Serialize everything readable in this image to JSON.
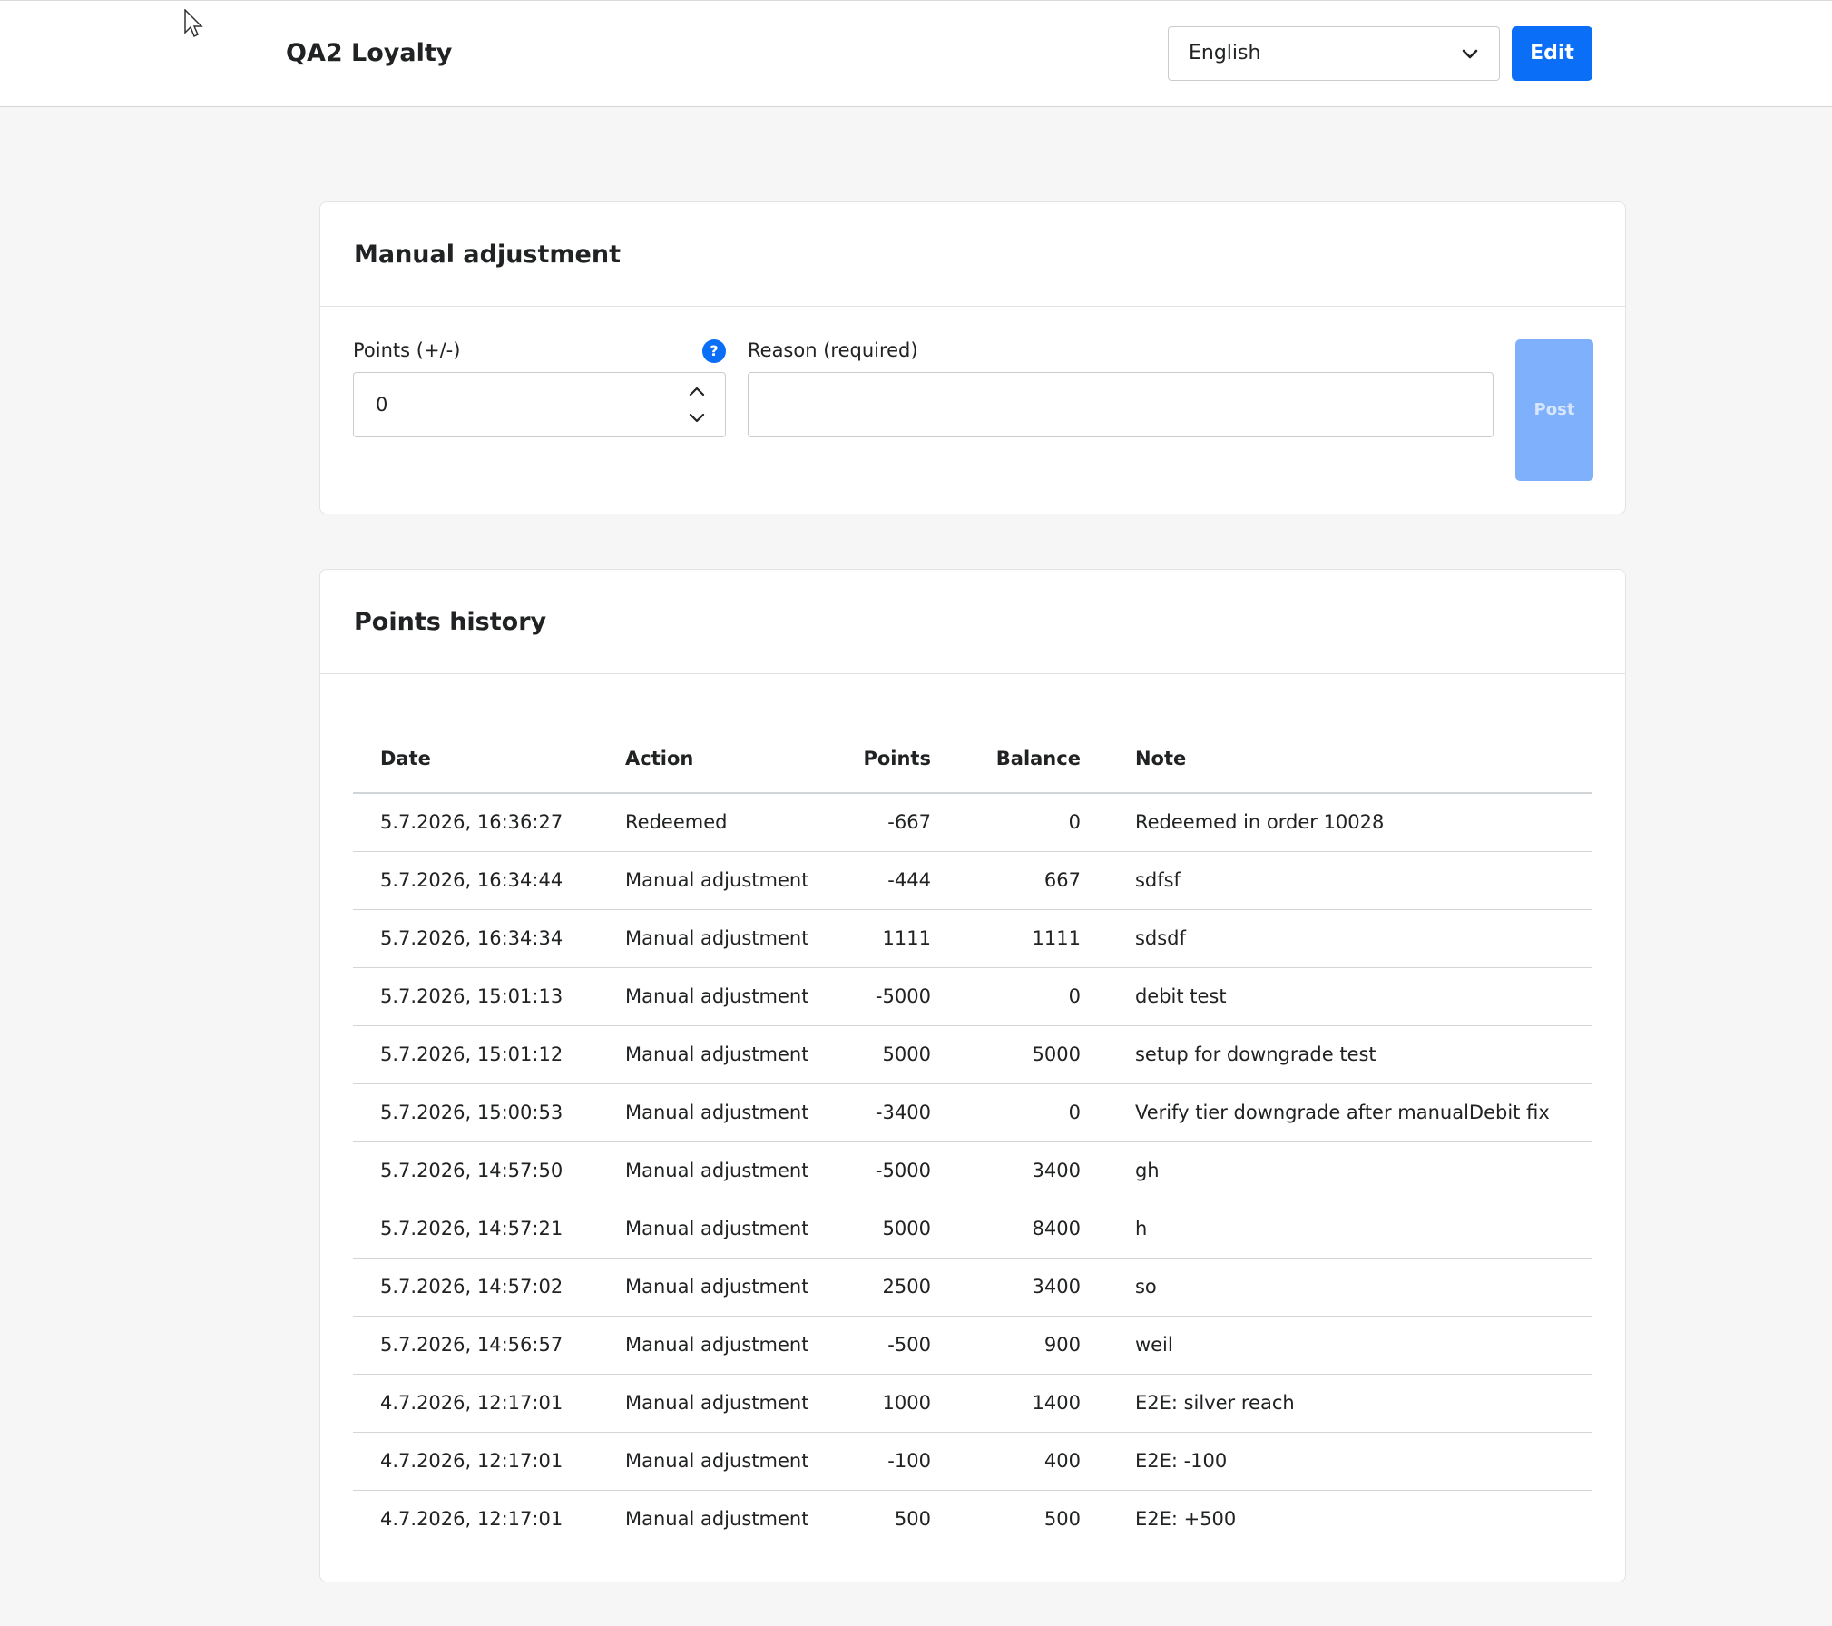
{
  "header": {
    "title": "QA2 Loyalty",
    "language": "English",
    "edit_label": "Edit"
  },
  "adjustment": {
    "title": "Manual adjustment",
    "points_label": "Points (+/-)",
    "points_value": "0",
    "help_glyph": "?",
    "reason_label": "Reason (required)",
    "reason_value": "",
    "post_label": "Post"
  },
  "history": {
    "title": "Points history",
    "columns": [
      "Date",
      "Action",
      "Points",
      "Balance",
      "Note"
    ],
    "rows": [
      [
        "5.7.2026, 16:36:27",
        "Redeemed",
        "-667",
        "0",
        "Redeemed in order 10028"
      ],
      [
        "5.7.2026, 16:34:44",
        "Manual adjustment",
        "-444",
        "667",
        "sdfsf"
      ],
      [
        "5.7.2026, 16:34:34",
        "Manual adjustment",
        "1111",
        "1111",
        "sdsdf"
      ],
      [
        "5.7.2026, 15:01:13",
        "Manual adjustment",
        "-5000",
        "0",
        "debit test"
      ],
      [
        "5.7.2026, 15:01:12",
        "Manual adjustment",
        "5000",
        "5000",
        "setup for downgrade test"
      ],
      [
        "5.7.2026, 15:00:53",
        "Manual adjustment",
        "-3400",
        "0",
        "Verify tier downgrade after manualDebit fix"
      ],
      [
        "5.7.2026, 14:57:50",
        "Manual adjustment",
        "-5000",
        "3400",
        "gh"
      ],
      [
        "5.7.2026, 14:57:21",
        "Manual adjustment",
        "5000",
        "8400",
        "h"
      ],
      [
        "5.7.2026, 14:57:02",
        "Manual adjustment",
        "2500",
        "3400",
        "so"
      ],
      [
        "5.7.2026, 14:56:57",
        "Manual adjustment",
        "-500",
        "900",
        "weil"
      ],
      [
        "4.7.2026, 12:17:01",
        "Manual adjustment",
        "1000",
        "1400",
        "E2E: silver reach"
      ],
      [
        "4.7.2026, 12:17:01",
        "Manual adjustment",
        "-100",
        "400",
        "E2E: -100"
      ],
      [
        "4.7.2026, 12:17:01",
        "Manual adjustment",
        "500",
        "500",
        "E2E: +500"
      ]
    ]
  },
  "colors": {
    "accent": "#0a6ef7",
    "post_disabled": "#7fb0fb",
    "page_bg": "#f6f6f7"
  },
  "icons": [
    "cursor-icon",
    "chevron-down-icon",
    "help-icon",
    "chevron-up-icon"
  ]
}
